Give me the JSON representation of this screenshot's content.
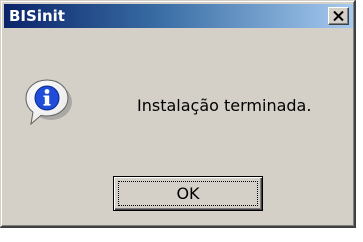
{
  "window": {
    "title": "BISinit",
    "close_glyph": "✕",
    "close_icon": "close-icon"
  },
  "dialog": {
    "icon": "info-icon",
    "icon_glyph": "i",
    "message": "Instalação terminada.",
    "ok_label": "OK"
  },
  "colors": {
    "title_gradient_start": "#0a246a",
    "title_gradient_end": "#a6caf0",
    "face": "#d4d0c8",
    "info_blue": "#1f4cd8"
  }
}
